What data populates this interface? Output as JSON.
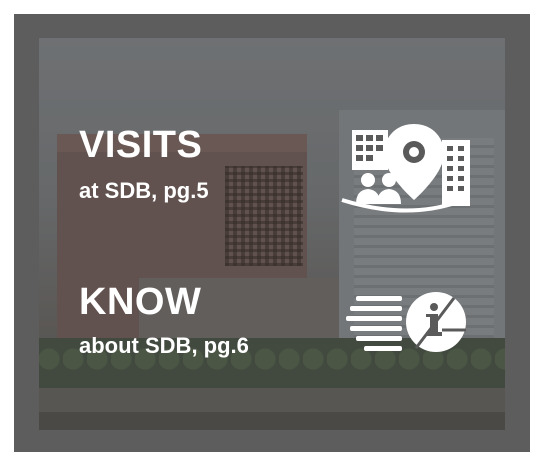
{
  "visits": {
    "title": "VISITS",
    "subtitle": "at SDB, pg.5",
    "icon": "visit-location-icon"
  },
  "know": {
    "title": "KNOW",
    "subtitle": "about SDB, pg.6",
    "icon": "info-document-icon"
  },
  "colors": {
    "text": "#ffffff",
    "panel": "#5d5d5d",
    "icon": "#ffffff"
  }
}
